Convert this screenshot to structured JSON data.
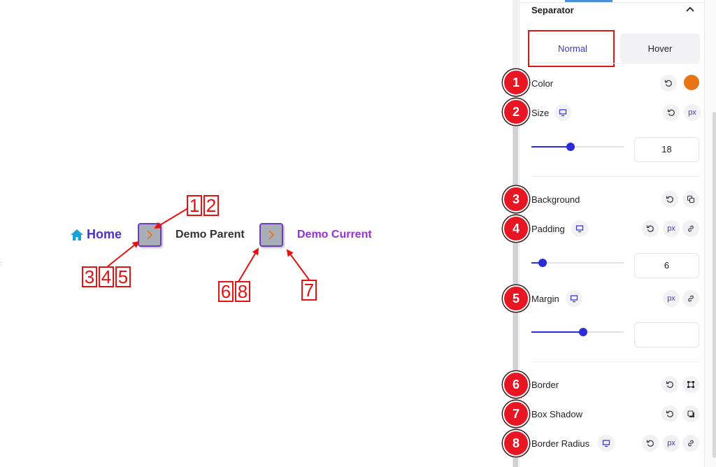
{
  "canvas": {
    "breadcrumb": {
      "home_label": "Home",
      "home_icon": "home-icon",
      "separator_icon": "chevron-right-icon",
      "parent_label": "Demo Parent",
      "current_label": "Demo Current"
    },
    "annotations": [
      {
        "digits": [
          "1",
          "2"
        ]
      },
      {
        "digits": [
          "3",
          "4",
          "5"
        ]
      },
      {
        "digits": [
          "6",
          "8"
        ]
      },
      {
        "digits": [
          "7"
        ]
      }
    ],
    "colors": {
      "home": "#4b2fd6",
      "home_icon": "#1aa3d9",
      "parent": "#333333",
      "current": "#9b2fd6",
      "separator_bg": "#a9adb8",
      "separator_border": "#6a3fb5",
      "separator_icon": "#e87416",
      "annotation": "#e81010"
    }
  },
  "panel": {
    "section_title": "Separator",
    "collapse_icon": "chevron-up-icon",
    "tabs": [
      {
        "label": "Normal",
        "active": true
      },
      {
        "label": "Hover",
        "active": false
      }
    ],
    "controls": [
      {
        "badge": "1",
        "label": "Color",
        "swatch": "#e87416"
      },
      {
        "badge": "2",
        "label": "Size",
        "unit": "px",
        "value": "18",
        "slider_fraction": 0.36
      },
      {
        "badge": "3",
        "label": "Background"
      },
      {
        "badge": "4",
        "label": "Padding",
        "unit": "px",
        "value": "6",
        "slider_fraction": 0.06
      },
      {
        "badge": "5",
        "label": "Margin",
        "unit": "px",
        "value": "",
        "slider_fraction": 0.5
      },
      {
        "badge": "6",
        "label": "Border"
      },
      {
        "badge": "7",
        "label": "Box Shadow"
      },
      {
        "badge": "8",
        "label": "Border Radius",
        "unit": "px"
      }
    ],
    "accent": "#2b2bd9",
    "badge_color": "#e81623"
  }
}
